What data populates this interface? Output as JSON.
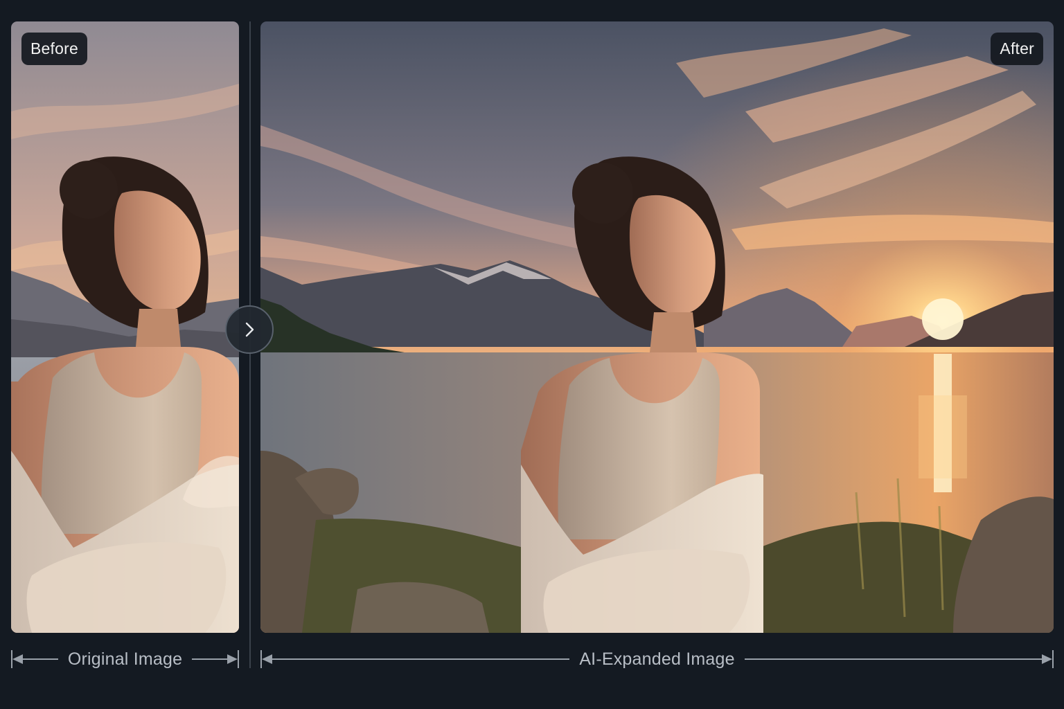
{
  "comparison": {
    "before_badge": "Before",
    "after_badge": "After",
    "original_caption": "Original Image",
    "expanded_caption": "AI-Expanded Image"
  },
  "icons": {
    "compare_handle": "chevron-right-icon"
  },
  "colors": {
    "app_background": "#141a22",
    "badge_background": "#14181e",
    "caption_text": "#b8bec6",
    "sky_top": "#4d5566",
    "sunset_glow": "#f6b06a",
    "sun": "#fff4cf"
  }
}
